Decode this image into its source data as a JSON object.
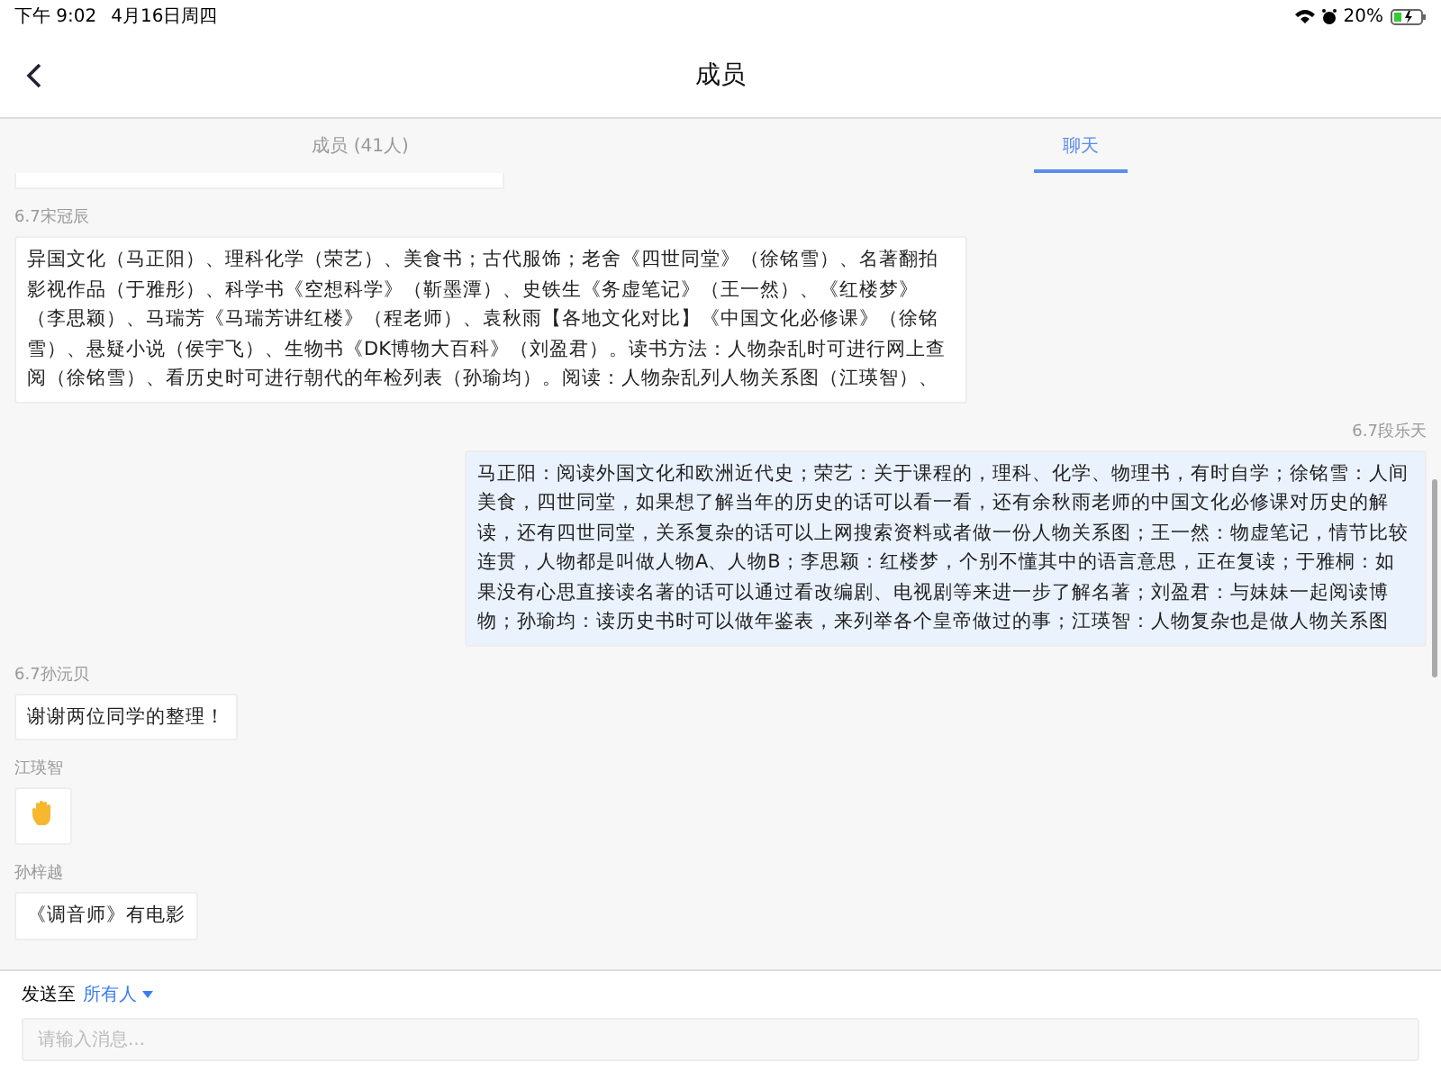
{
  "status_bar": {
    "time": "下午 9:02",
    "date": "4月16日周四",
    "battery": "20%"
  },
  "header": {
    "title": "成员"
  },
  "tabs": [
    {
      "label": "成员 (41人)",
      "selected": false
    },
    {
      "label": "聊天",
      "selected": true
    }
  ],
  "messages": [
    {
      "kind": "cut",
      "outgoing": false
    },
    {
      "kind": "text",
      "outgoing": false,
      "sender": "6.7宋冠辰",
      "text": "异国文化（马正阳）、理科化学（荣艺）、美食书；古代服饰；老舍《四世同堂》（徐铭雪）、名著翻拍影视作品（于雅彤）、科学书《空想科学》（靳墨潭）、史铁生《务虚笔记》（王一然）、《红楼梦》（李思颖）、马瑞芳《马瑞芳讲红楼》（程老师）、袁秋雨【各地文化对比】《中国文化必修课》（徐铭雪）、悬疑小说（侯宇飞）、生物书《DK博物大百科》（刘盈君）。读书方法：人物杂乱时可进行网上查阅（徐铭雪）、看历史时可进行朝代的年检列表（孙瑜均）。阅读：人物杂乱列人物关系图（江瑛智）、"
    },
    {
      "kind": "text",
      "outgoing": true,
      "sender": "6.7段乐天",
      "text": "马正阳：阅读外国文化和欧洲近代史；荣艺：关于课程的，理科、化学、物理书，有时自学；徐铭雪：人间美食，四世同堂，如果想了解当年的历史的话可以看一看，还有余秋雨老师的中国文化必修课对历史的解读，还有四世同堂，关系复杂的话可以上网搜索资料或者做一份人物关系图；王一然：物虚笔记，情节比较连贯，人物都是叫做人物A、人物B；李思颖：红楼梦，个别不懂其中的语言意思，正在复读；于雅桐：如果没有心思直接读名著的话可以通过看改编剧、电视剧等来进一步了解名著；刘盈君：与妹妹一起阅读博物；孙瑜均：读历史书时可以做年鉴表，来列举各个皇帝做过的事；江瑛智：人物复杂也是做人物关系图"
    },
    {
      "kind": "text",
      "outgoing": false,
      "sender": "6.7孙沅贝",
      "text": "谢谢两位同学的整理！"
    },
    {
      "kind": "hand",
      "outgoing": false,
      "sender": "江瑛智"
    },
    {
      "kind": "text",
      "outgoing": false,
      "sender": "孙梓越",
      "text": "《调音师》有电影"
    }
  ],
  "footer": {
    "send_to": "发送至",
    "recipient": "所有人",
    "input": {
      "placeholder": "请输入消息..."
    }
  }
}
